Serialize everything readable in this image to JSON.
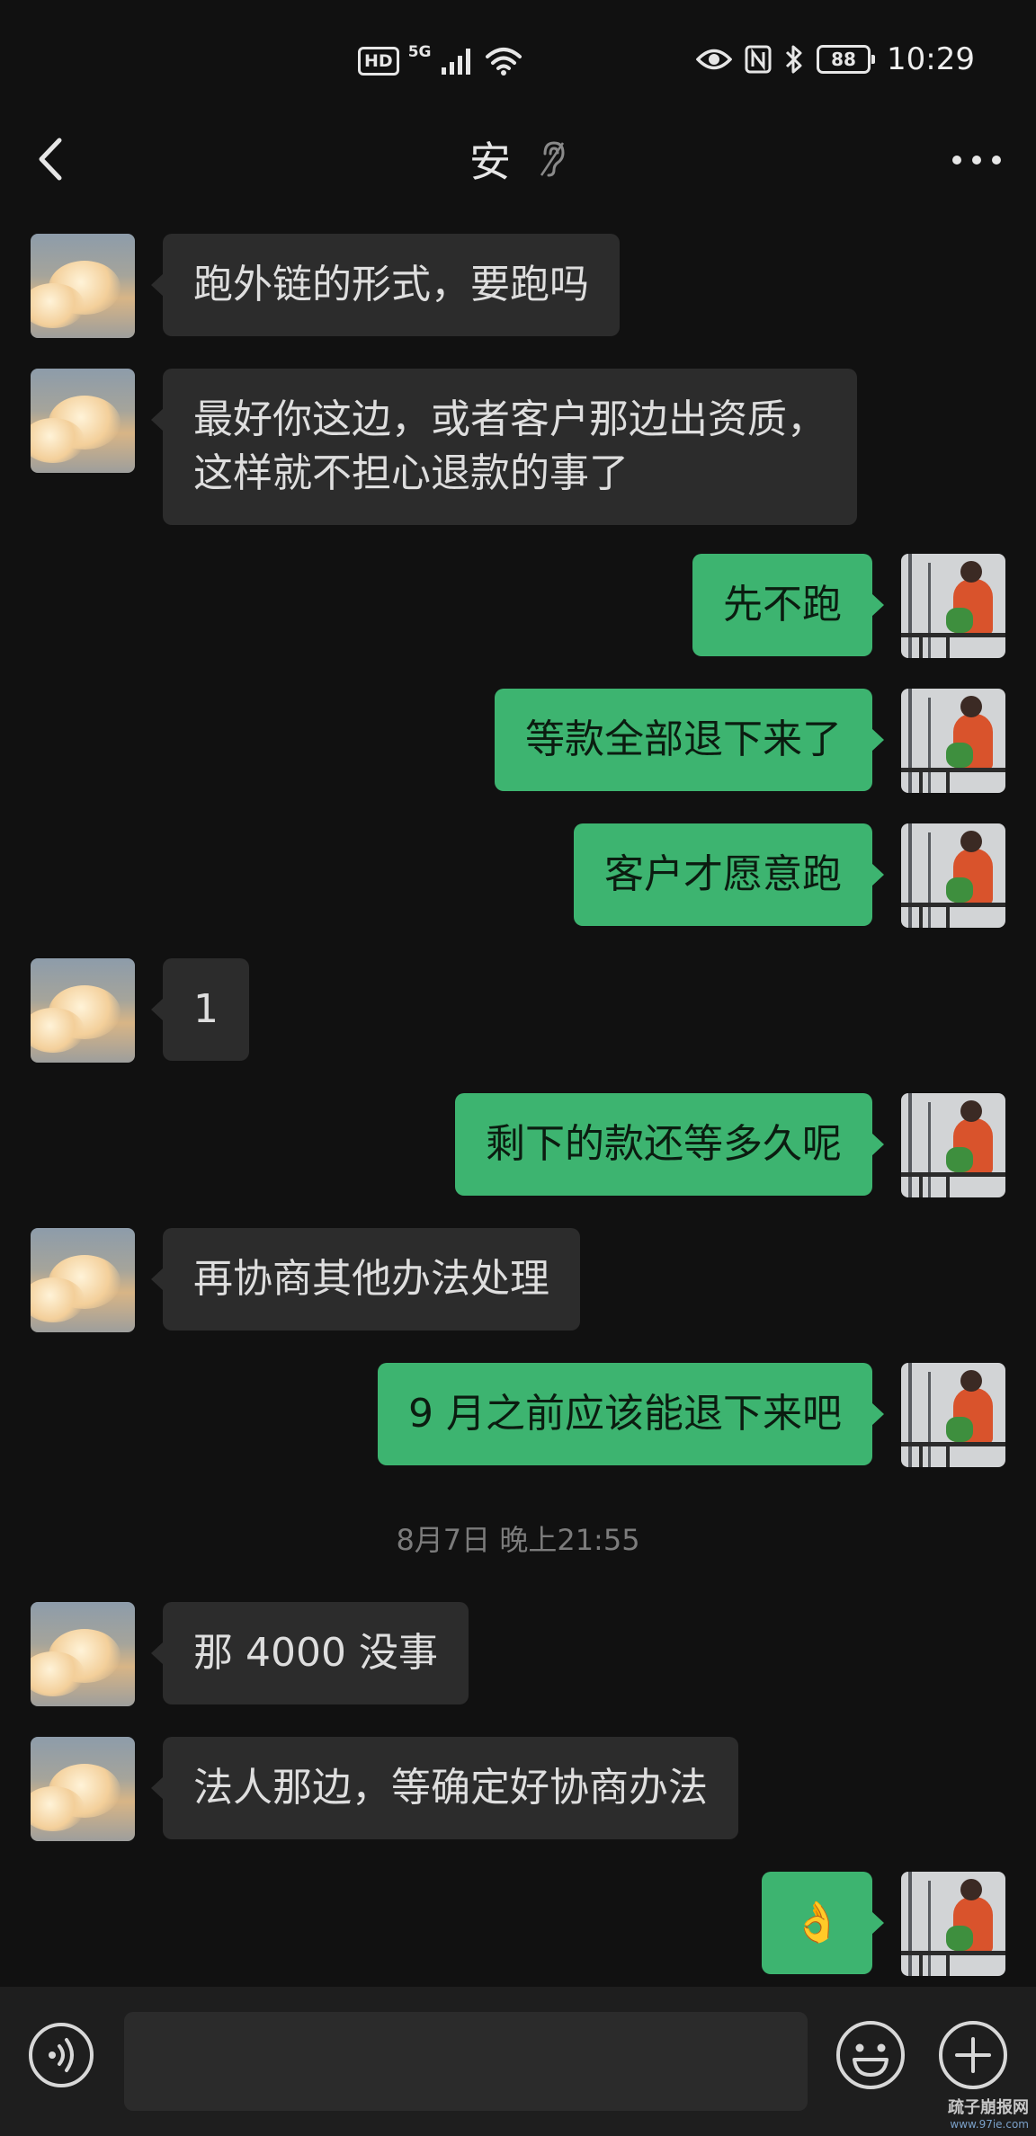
{
  "status_bar": {
    "hd_label": "HD",
    "network_label": "5G",
    "battery_level": "88",
    "time": "10:29",
    "icons": [
      "signal-icon",
      "wifi-icon",
      "eye-icon",
      "nfc-icon",
      "bluetooth-icon",
      "battery-icon"
    ]
  },
  "header": {
    "title": "安",
    "icons": {
      "back": "chevron-left-icon",
      "mute": "ear-muted-icon",
      "more": "more-dots-icon"
    }
  },
  "messages": [
    {
      "side": "left",
      "lines": [
        "跑外链的形式，要跑吗"
      ]
    },
    {
      "side": "left",
      "lines": [
        "最好你这边，或者客户那边出资质，",
        "这样就不担心退款的事了"
      ]
    },
    {
      "side": "right",
      "lines": [
        "先不跑"
      ]
    },
    {
      "side": "right",
      "lines": [
        "等款全部退下来了"
      ]
    },
    {
      "side": "right",
      "lines": [
        "客户才愿意跑"
      ]
    },
    {
      "side": "left",
      "lines": [
        "1"
      ]
    },
    {
      "side": "right",
      "lines": [
        "剩下的款还等多久呢"
      ]
    },
    {
      "side": "left",
      "lines": [
        "再协商其他办法处理"
      ]
    },
    {
      "side": "right",
      "lines": [
        "9 月之前应该能退下来吧"
      ]
    },
    {
      "side": "left",
      "lines": [
        "那 4000 没事"
      ]
    },
    {
      "side": "left",
      "lines": [
        "法人那边，等确定好协商办法"
      ]
    },
    {
      "side": "right",
      "lines": [
        "👌"
      ]
    }
  ],
  "timestamp": "8月7日 晚上21:55",
  "input_bar": {
    "text_value": "",
    "icons": {
      "voice": "voice-icon",
      "emoji": "emoji-icon",
      "plus": "plus-icon"
    }
  },
  "watermark": {
    "main": "疏子崩报网",
    "sub": "www.97ie.com"
  },
  "colors": {
    "background": "#111111",
    "bubble_left": "#2c2c2c",
    "bubble_right": "#3db470",
    "input_bar": "#1e1e1e"
  }
}
